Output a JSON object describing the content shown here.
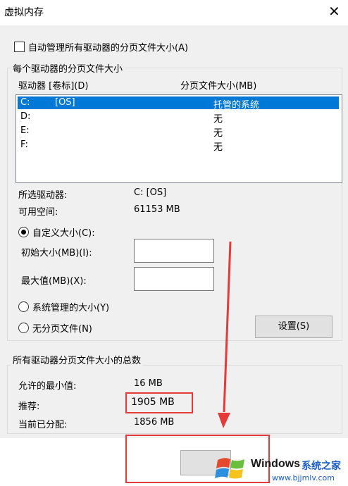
{
  "window": {
    "title": "虚拟内存",
    "close_glyph": "✕"
  },
  "auto_manage": {
    "label": "自动管理所有驱动器的分页文件大小(A)",
    "checked": false
  },
  "per_drive": {
    "group_title": "每个驱动器的分页文件大小",
    "col_drive": "驱动器 [卷标](D)",
    "col_size": "分页文件大小(MB)",
    "rows": [
      {
        "drive": "C:",
        "label": "[OS]",
        "size": "托管的系统",
        "selected": true
      },
      {
        "drive": "D:",
        "label": "",
        "size": "无",
        "selected": false
      },
      {
        "drive": "E:",
        "label": "",
        "size": "无",
        "selected": false
      },
      {
        "drive": "F:",
        "label": "",
        "size": "无",
        "selected": false
      }
    ],
    "selected_drive_label": "所选驱动器:",
    "selected_drive_value": "C:  [OS]",
    "free_space_label": "可用空间:",
    "free_space_value": "61153 MB",
    "custom_size_label": "自定义大小(C):",
    "initial_label": "初始大小(MB)(I):",
    "initial_value": "",
    "max_label": "最大值(MB)(X):",
    "max_value": "",
    "system_managed_label": "系统管理的大小(Y)",
    "no_paging_label": "无分页文件(N)",
    "set_button": "设置(S)"
  },
  "totals": {
    "group_title": "所有驱动器分页文件大小的总数",
    "min_label": "允许的最小值:",
    "min_value": "16 MB",
    "recommended_label": "推荐:",
    "recommended_value": "1905 MB",
    "allocated_label": "当前已分配:",
    "allocated_value": "1856 MB"
  },
  "watermark": {
    "brand": "Windows",
    "site_cn": "系统之家",
    "url": "www.bjjmlv.com"
  },
  "colors": {
    "highlight": "#e43a3a",
    "selection": "#0078d7",
    "arrow": "#e43a3a"
  }
}
